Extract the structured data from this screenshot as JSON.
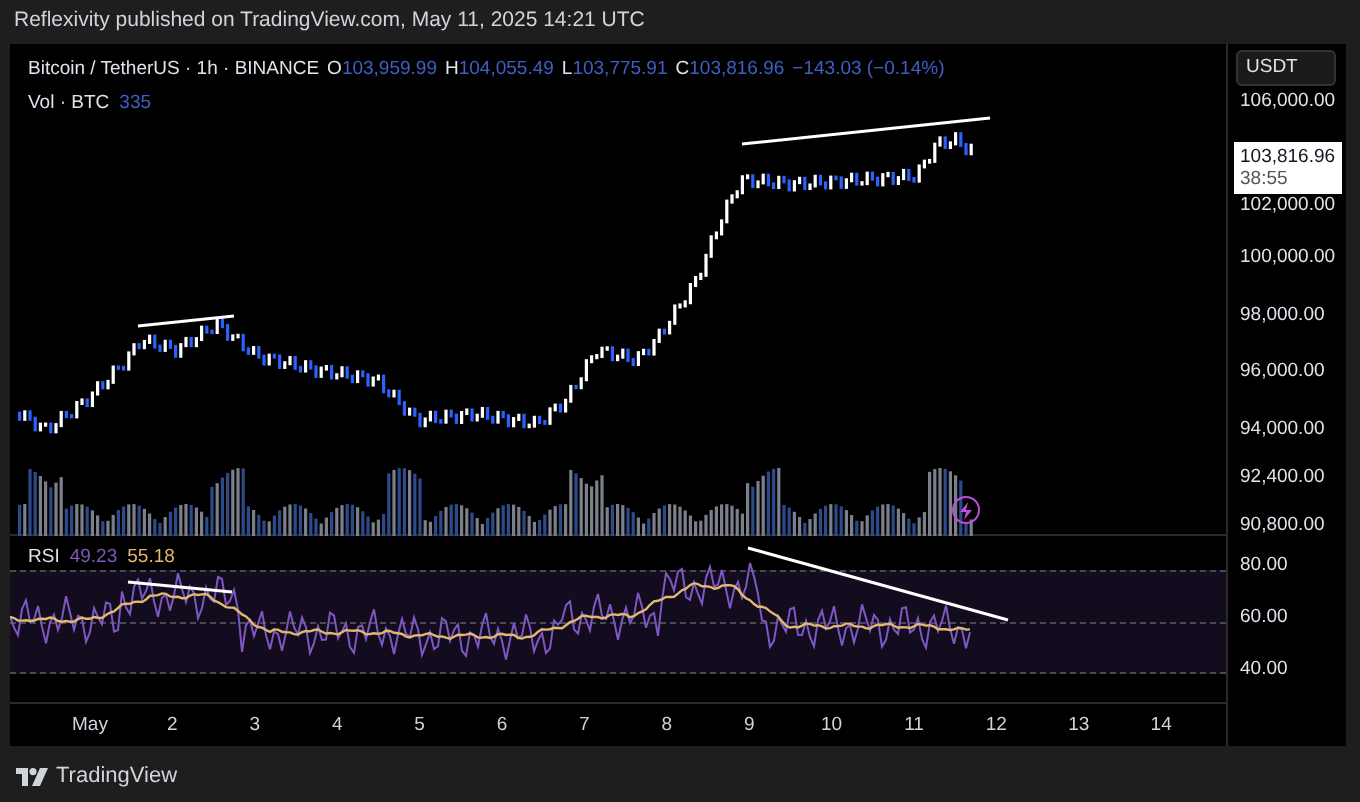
{
  "header": {
    "text": "Reflexivity published on TradingView.com, May 11, 2025 14:21 UTC"
  },
  "legend": {
    "symbol": "Bitcoin / TetherUS · 1h · BINANCE",
    "ohlc": [
      {
        "key": "O",
        "value": "103,959.99"
      },
      {
        "key": "H",
        "value": "104,055.49"
      },
      {
        "key": "L",
        "value": "103,775.91"
      },
      {
        "key": "C",
        "value": "103,816.96"
      }
    ],
    "change": "−143.03 (−0.14%)"
  },
  "volume": {
    "label": "Vol · BTC",
    "value": "335"
  },
  "currency_button": "USDT",
  "price_axis": [
    "106,000.00",
    "102,000.00",
    "100,000.00",
    "98,000.00",
    "96,000.00",
    "94,000.00",
    "92,400.00",
    "90,800.00"
  ],
  "price_tag": {
    "price": "103,816.96",
    "countdown": "38:55"
  },
  "rsi": {
    "label": "RSI",
    "value": "49.23",
    "ma_value": "55.18",
    "axis": [
      "80.00",
      "60.00",
      "40.00"
    ]
  },
  "time_axis": [
    "May",
    "2",
    "3",
    "4",
    "5",
    "6",
    "7",
    "8",
    "9",
    "10",
    "11",
    "12",
    "13",
    "14"
  ],
  "footer": {
    "brand": "TradingView"
  }
}
